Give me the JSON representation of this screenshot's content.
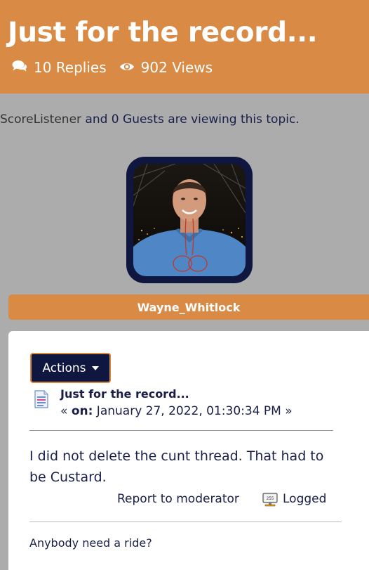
{
  "topic": {
    "title": "Just for the record...",
    "replies_label": "10 Replies",
    "views_label": "902 Views"
  },
  "viewing": {
    "user": "ScoreListener",
    "rest": " and 0 Guests are viewing this topic."
  },
  "post": {
    "author": "Wayne_Whitlock",
    "actions_label": "Actions",
    "subject": "Just for the record...",
    "date_prefix": "« ",
    "date_on": "on:",
    "date_value": " January 27, 2022, 01:30:34 PM »",
    "body": "I did not delete the cunt thread.  That had to be Custard.",
    "report_label": "Report to moderator",
    "logged_label": "Logged",
    "signature": "Anybody need a ride?"
  },
  "colors": {
    "accent": "#d98a44",
    "navy": "#0f1740",
    "page_bg": "#acacac"
  },
  "icons": {
    "replies": "comments-icon",
    "views": "eye-icon",
    "post": "document-icon",
    "logged": "ip-monitor-icon"
  }
}
